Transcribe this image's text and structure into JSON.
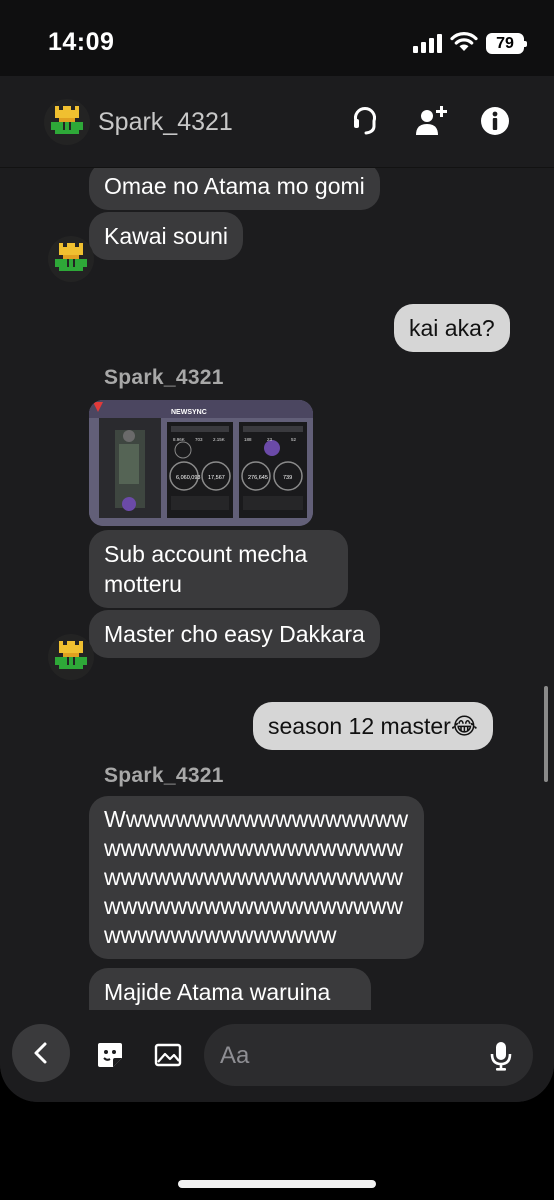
{
  "status_bar": {
    "time": "14:09",
    "battery": "79"
  },
  "header": {
    "contact_name": "Spark_4321"
  },
  "messages": [
    {
      "side": "in",
      "text": "Omae no Atama mo gomi"
    },
    {
      "side": "in",
      "text": "Kawai souni"
    },
    {
      "side": "out",
      "text": "kai aka?"
    },
    {
      "side": "in",
      "sender": "Spark_4321"
    },
    {
      "side": "in",
      "text": "Sub account mecha motteru"
    },
    {
      "side": "in",
      "text": "Master cho easy Dakkara"
    },
    {
      "side": "out",
      "text": "season 12 master😂"
    },
    {
      "side": "in",
      "sender": "Spark_4321"
    },
    {
      "side": "in",
      "text": "Wwwwwwwwwwwwwwwwwwwwwwwwwwwwwwwwwwwwwwwwwwwwwwwwwwwwwwwwwwwwwwwwwwwwwwwwwwwwwwwwwwwwww"
    },
    {
      "side": "in",
      "text": "Majide Atama waruina omae"
    }
  ],
  "shared_image": {
    "title": "NEWSYNC",
    "stats": [
      "6,060,093",
      "17,567",
      "276,645",
      "739",
      "8.96K",
      "703",
      "2.15K",
      "188",
      "23",
      "52"
    ]
  },
  "composer": {
    "placeholder": "Aa"
  },
  "colors": {
    "background": "#1c1c1e",
    "incoming_bubble": "#3a3a3c",
    "outgoing_bubble": "#d6d6d6",
    "avatar_flower": "#f0c030",
    "avatar_leaf": "#2ea838"
  }
}
